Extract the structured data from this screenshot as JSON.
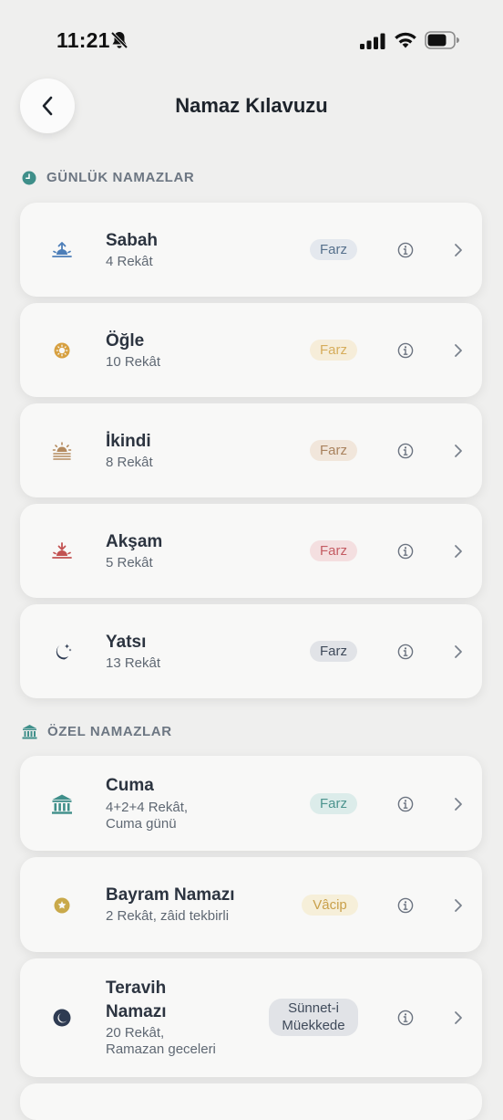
{
  "status": {
    "time": "11:21"
  },
  "header": {
    "title": "Namaz Kılavuzu"
  },
  "sections": [
    {
      "label": "GÜNLÜK NAMAZLAR",
      "icon": "clock-icon",
      "color": "#3f8f8a"
    },
    {
      "label": "ÖZEL NAMAZLAR",
      "icon": "mosque-icon",
      "color": "#3f8f8a"
    }
  ],
  "daily": [
    {
      "name": "Sabah",
      "sub": "4 Rekât",
      "badge": "Farz",
      "icon": "sunrise-icon",
      "color": "#4d7eb8"
    },
    {
      "name": "Öğle",
      "sub": "10 Rekât",
      "badge": "Farz",
      "icon": "sun-icon",
      "color": "#d7a040"
    },
    {
      "name": "İkindi",
      "sub": "8 Rekât",
      "badge": "Farz",
      "icon": "sun-haze-icon",
      "color": "#b48a5e"
    },
    {
      "name": "Akşam",
      "sub": "5 Rekât",
      "badge": "Farz",
      "icon": "sunset-icon",
      "color": "#c25252"
    },
    {
      "name": "Yatsı",
      "sub": "13 Rekât",
      "badge": "Farz",
      "icon": "moon-stars-icon",
      "color": "#2e3b52"
    }
  ],
  "special": [
    {
      "name": "Cuma",
      "sub1": "4+2+4 Rekât,",
      "sub2": "Cuma günü",
      "badge": "Farz",
      "icon": "mosque-icon",
      "color": "#3f8f8a"
    },
    {
      "name": "Bayram Namazı",
      "sub1": "2 Rekât, zâid tekbirli",
      "badge": "Vâcip",
      "icon": "star-circle-icon",
      "color": "#c9a94a"
    },
    {
      "name1": "Teravih",
      "name2": "Namazı",
      "sub1": "20 Rekât,",
      "sub2": "Ramazan geceleri",
      "badge1": "Sünnet-i",
      "badge2": "Müekkede",
      "icon": "moon-icon",
      "color": "#2e3b52"
    }
  ]
}
